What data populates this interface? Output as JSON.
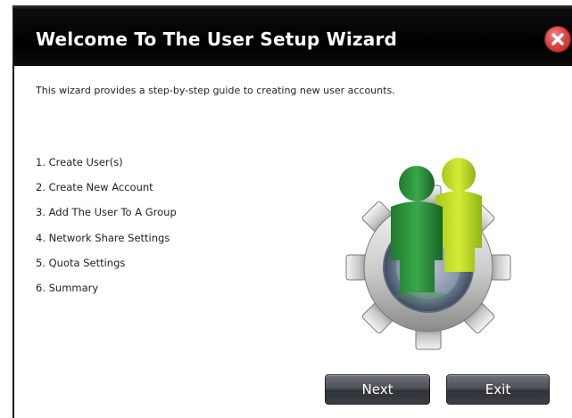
{
  "dialog": {
    "title": "Welcome To The User Setup Wizard",
    "intro": "This wizard provides a step-by-step guide to creating new user accounts.",
    "steps": [
      "1. Create User(s)",
      "2. Create New Account",
      "3. Add The User To A Group",
      "4. Network Share Settings",
      "5. Quota Settings",
      "6. Summary"
    ],
    "buttons": {
      "next": "Next",
      "exit": "Exit"
    },
    "icons": {
      "close": "close-icon",
      "illustration": "users-gear-icon"
    },
    "colors": {
      "titlebar": "#000000",
      "close": "#d94545",
      "button": "#4d5157"
    }
  }
}
